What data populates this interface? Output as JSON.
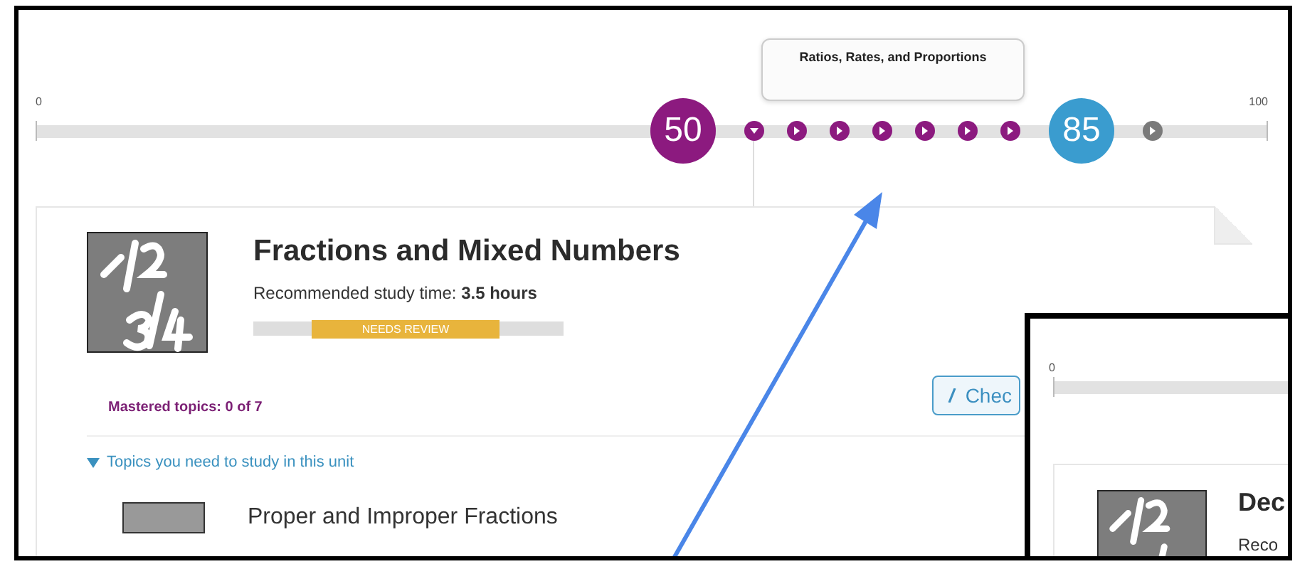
{
  "timeline": {
    "start_label": "0",
    "end_label": "100",
    "markers": [
      {
        "kind": "score",
        "label": "50",
        "color": "#8c1a7f"
      },
      {
        "kind": "step",
        "expanded": true,
        "color": "#8c1a7f"
      },
      {
        "kind": "step",
        "expanded": false,
        "color": "#8c1a7f"
      },
      {
        "kind": "step",
        "expanded": false,
        "color": "#8c1a7f"
      },
      {
        "kind": "step",
        "expanded": false,
        "color": "#8c1a7f",
        "tooltip": "Ratios, Rates, and Proportions"
      },
      {
        "kind": "step",
        "expanded": false,
        "color": "#8c1a7f"
      },
      {
        "kind": "step",
        "expanded": false,
        "color": "#8c1a7f"
      },
      {
        "kind": "step",
        "expanded": false,
        "color": "#8c1a7f"
      },
      {
        "kind": "score",
        "label": "85",
        "color": "#3a9ccf"
      },
      {
        "kind": "step",
        "expanded": false,
        "color": "#7a7a7a"
      }
    ]
  },
  "unit": {
    "title": "Fractions and Mixed Numbers",
    "study_time": "Recommended study time: **3.5 hours**",
    "status": "NEEDS REVIEW",
    "check_button": "Chec",
    "mastered": "Mastered topics: 0 of 7",
    "topics_toggle": {
      "label": "Topics you need to study in this unit",
      "expanded": true
    },
    "topics": [
      {
        "title": "Proper and Improper Fractions"
      }
    ]
  },
  "inset": {
    "start_label": "0",
    "title": "Dec",
    "study_time": "Reco"
  }
}
